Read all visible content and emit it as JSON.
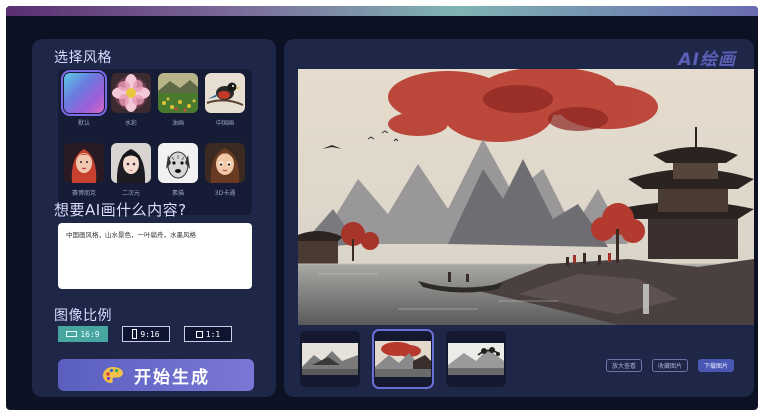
{
  "style_section": {
    "title": "选择风格",
    "styles": [
      {
        "label": "默认",
        "icon": "gradient-swatch-icon",
        "selected": true
      },
      {
        "label": "水彩",
        "icon": "flower-icon",
        "selected": false
      },
      {
        "label": "油画",
        "icon": "landscape-icon",
        "selected": false
      },
      {
        "label": "中国画",
        "icon": "bird-icon",
        "selected": false
      },
      {
        "label": "赛博朋克",
        "icon": "portrait-red-hair-icon",
        "selected": false
      },
      {
        "label": "二次元",
        "icon": "portrait-anime-icon",
        "selected": false
      },
      {
        "label": "素描",
        "icon": "dog-sketch-icon",
        "selected": false
      },
      {
        "label": "3D卡通",
        "icon": "portrait-3d-icon",
        "selected": false
      }
    ]
  },
  "prompt_section": {
    "title": "想要AI画什么内容?",
    "value": "中国画风格，山水景色，一叶扁舟，水墨风格"
  },
  "ratio_section": {
    "title": "图像比例",
    "options": [
      {
        "label": "16:9",
        "selected": true
      },
      {
        "label": "9:16",
        "selected": false
      },
      {
        "label": "1:1",
        "selected": false
      }
    ]
  },
  "generate_button": {
    "label": "开始生成",
    "icon": "palette-icon"
  },
  "brand": "AI绘画",
  "preview": {
    "icon": "generated-landscape-image"
  },
  "thumbnails": [
    {
      "icon": "ink-landscape-thumb-icon",
      "selected": false
    },
    {
      "icon": "red-pagoda-thumb-icon",
      "selected": true
    },
    {
      "icon": "ink-tree-thumb-icon",
      "selected": false
    }
  ],
  "actions": {
    "zoom": "放大查看",
    "favorite": "收藏图片",
    "download": "下载图片"
  },
  "colors": {
    "background": "#0d1124",
    "panel": "#1e2748",
    "accent": "#6a6fd6",
    "ratio_active": "#47a6a0"
  }
}
